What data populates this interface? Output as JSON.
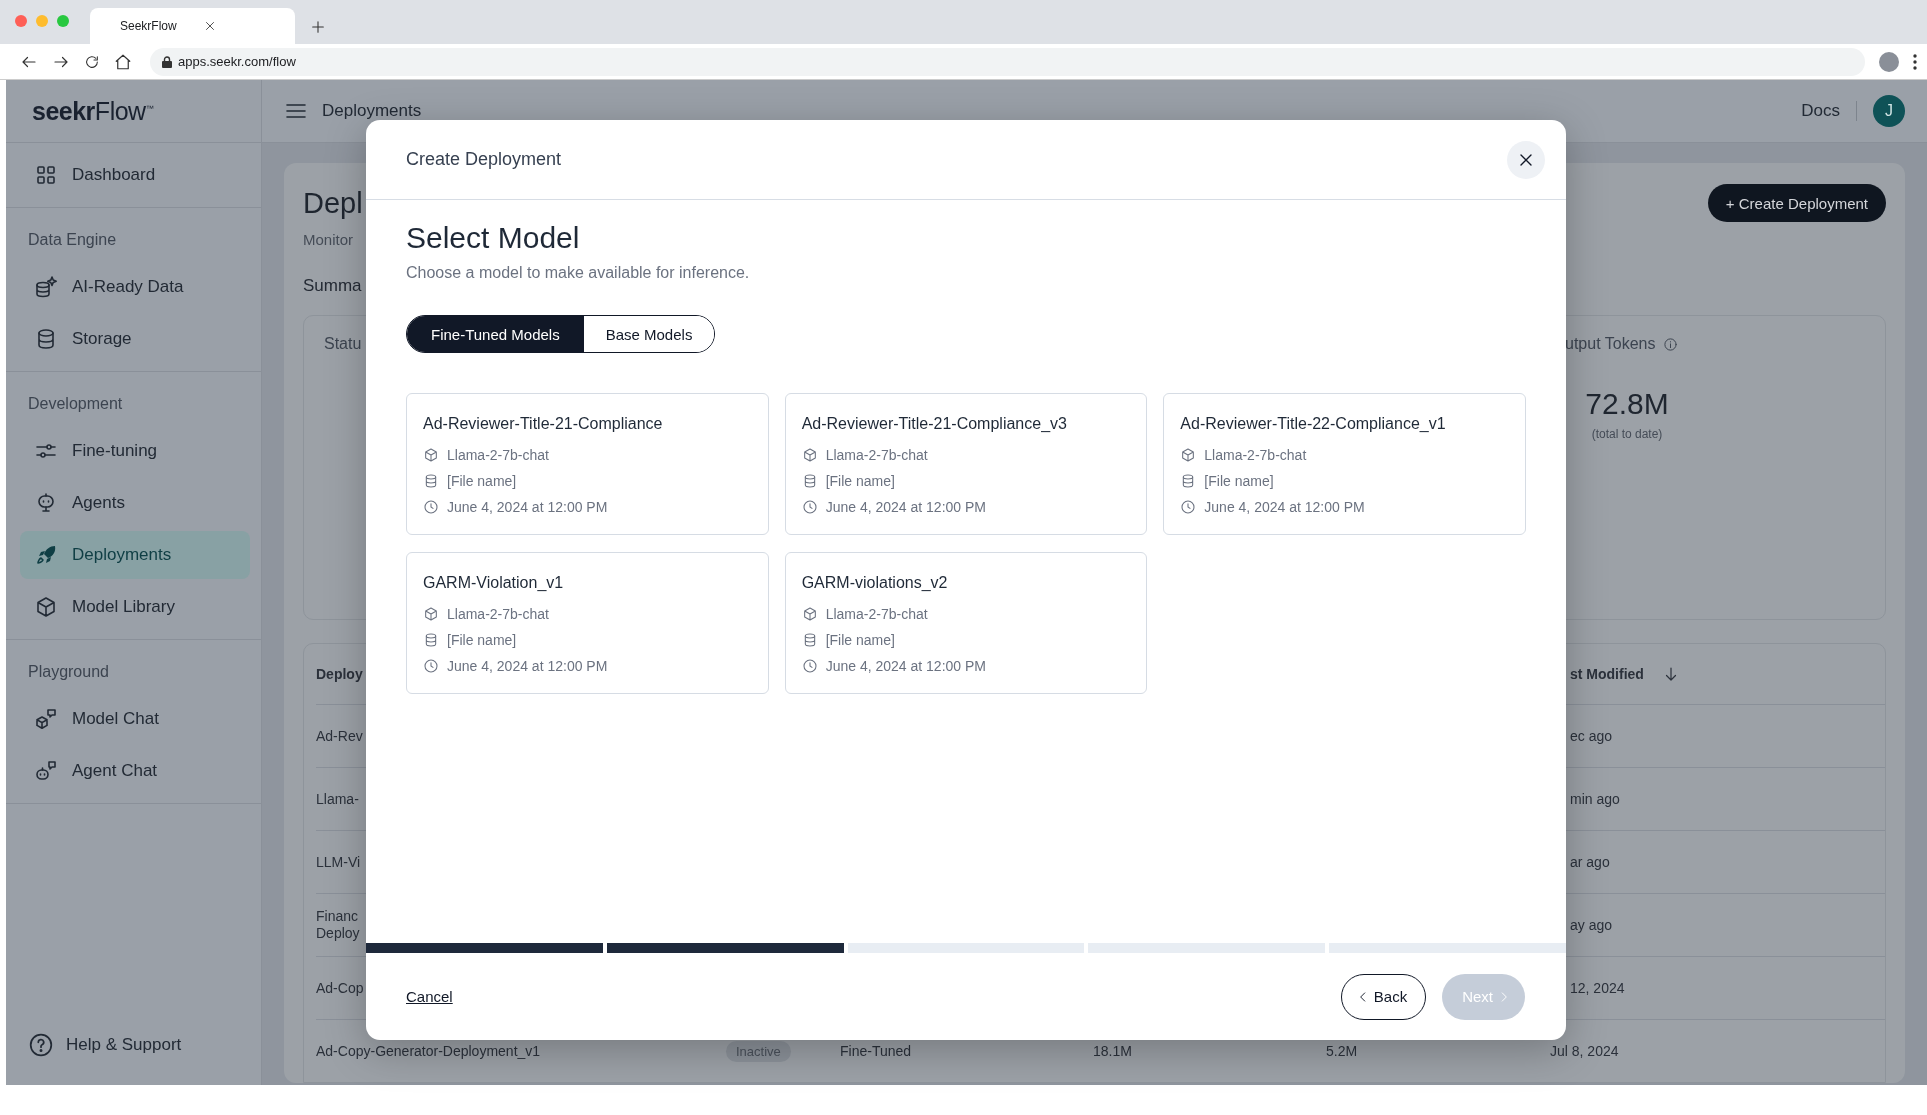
{
  "browser": {
    "tab_title": "SeekrFlow",
    "url": "apps.seekr.com/flow"
  },
  "sidebar": {
    "logo": "**seekr**Flow$^{™}$",
    "sections": [
      {
        "items": [
          {
            "label": "Dashboard",
            "selected": false
          }
        ]
      },
      {
        "heading": "Data Engine",
        "items": [
          {
            "label": "AI-Ready Data",
            "selected": false
          },
          {
            "label": "Storage",
            "selected": false
          }
        ]
      },
      {
        "heading": "Development",
        "items": [
          {
            "label": "Fine-tuning",
            "selected": false
          },
          {
            "label": "Agents",
            "selected": false
          },
          {
            "label": "Deployments",
            "selected": true
          },
          {
            "label": "Model Library",
            "selected": false
          }
        ]
      },
      {
        "heading": "Playground",
        "items": [
          {
            "label": "Model Chat",
            "selected": false
          },
          {
            "label": "Agent Chat",
            "selected": false
          }
        ]
      }
    ],
    "footer_link": "Help & Support"
  },
  "header": {
    "title": "Deployments",
    "docs_link": "Docs",
    "avatar": "J"
  },
  "page": {
    "title": "Depl",
    "subtitle": "Monitor",
    "create_button": "+ Create Deployment",
    "summary_heading": "Summa",
    "summary": {
      "status_label": "Statu",
      "output_tokens_label": "utput Tokens",
      "output_tokens_value": "72.8M",
      "output_tokens_note": "(total to date)"
    },
    "table": {
      "header": {
        "column_1": "Deploy",
        "column_6": "st Modified"
      },
      "rows": [
        {
          "column_1": "Ad-Rev",
          "column_6": "ec ago"
        },
        {
          "column_1": "Llama-",
          "column_6": "min ago"
        },
        {
          "column_1": "LLM-Vi",
          "column_6": "ar ago"
        },
        {
          "column_1": "Financ\nDeploy",
          "column_6": "ay ago"
        },
        {
          "column_1": "Ad-Cop",
          "column_6": "12, 2024"
        },
        {
          "column_1": "Ad-Copy-Generator-Deployment_v1",
          "column_2": "Inactive",
          "column_3": "Fine-Tuned",
          "column_4": "18.1M",
          "column_5": "5.2M",
          "column_6": "Jul 8, 2024"
        }
      ]
    }
  },
  "modal": {
    "title": "Create Deployment",
    "heading": "Select Model",
    "description": "Choose a model to make available for inference.",
    "tabs": [
      {
        "label": "Fine-Tuned Models",
        "selected": true
      },
      {
        "label": "Base Models",
        "selected": false
      }
    ],
    "models": [
      {
        "name": "Ad-Reviewer-Title-21-Compliance",
        "base_model": "Llama-2-7b-chat",
        "dataset": "[File name]",
        "created": "June 4, 2024 at 12:00 PM"
      },
      {
        "name": "Ad-Reviewer-Title-21-Compliance_v3",
        "base_model": "Llama-2-7b-chat",
        "dataset": "[File name]",
        "created": "June 4, 2024 at 12:00 PM"
      },
      {
        "name": "Ad-Reviewer-Title-22-Compliance_v1",
        "base_model": "Llama-2-7b-chat",
        "dataset": "[File name]",
        "created": "June 4, 2024 at 12:00 PM"
      },
      {
        "name": "GARM-Violation_v1",
        "base_model": "Llama-2-7b-chat",
        "dataset": "[File name]",
        "created": "June 4, 2024 at 12:00 PM"
      },
      {
        "name": "GARM-violations_v2",
        "base_model": "Llama-2-7b-chat",
        "dataset": "[File name]",
        "created": "June 4, 2024 at 12:00 PM"
      }
    ],
    "steps": [
      {
        "complete": true
      },
      {
        "complete": true
      },
      {
        "complete": false
      },
      {
        "complete": false
      },
      {
        "complete": false
      }
    ],
    "cancel": "Cancel",
    "back": "Back",
    "next": {
      "label": "Next",
      "disabled": true
    }
  }
}
